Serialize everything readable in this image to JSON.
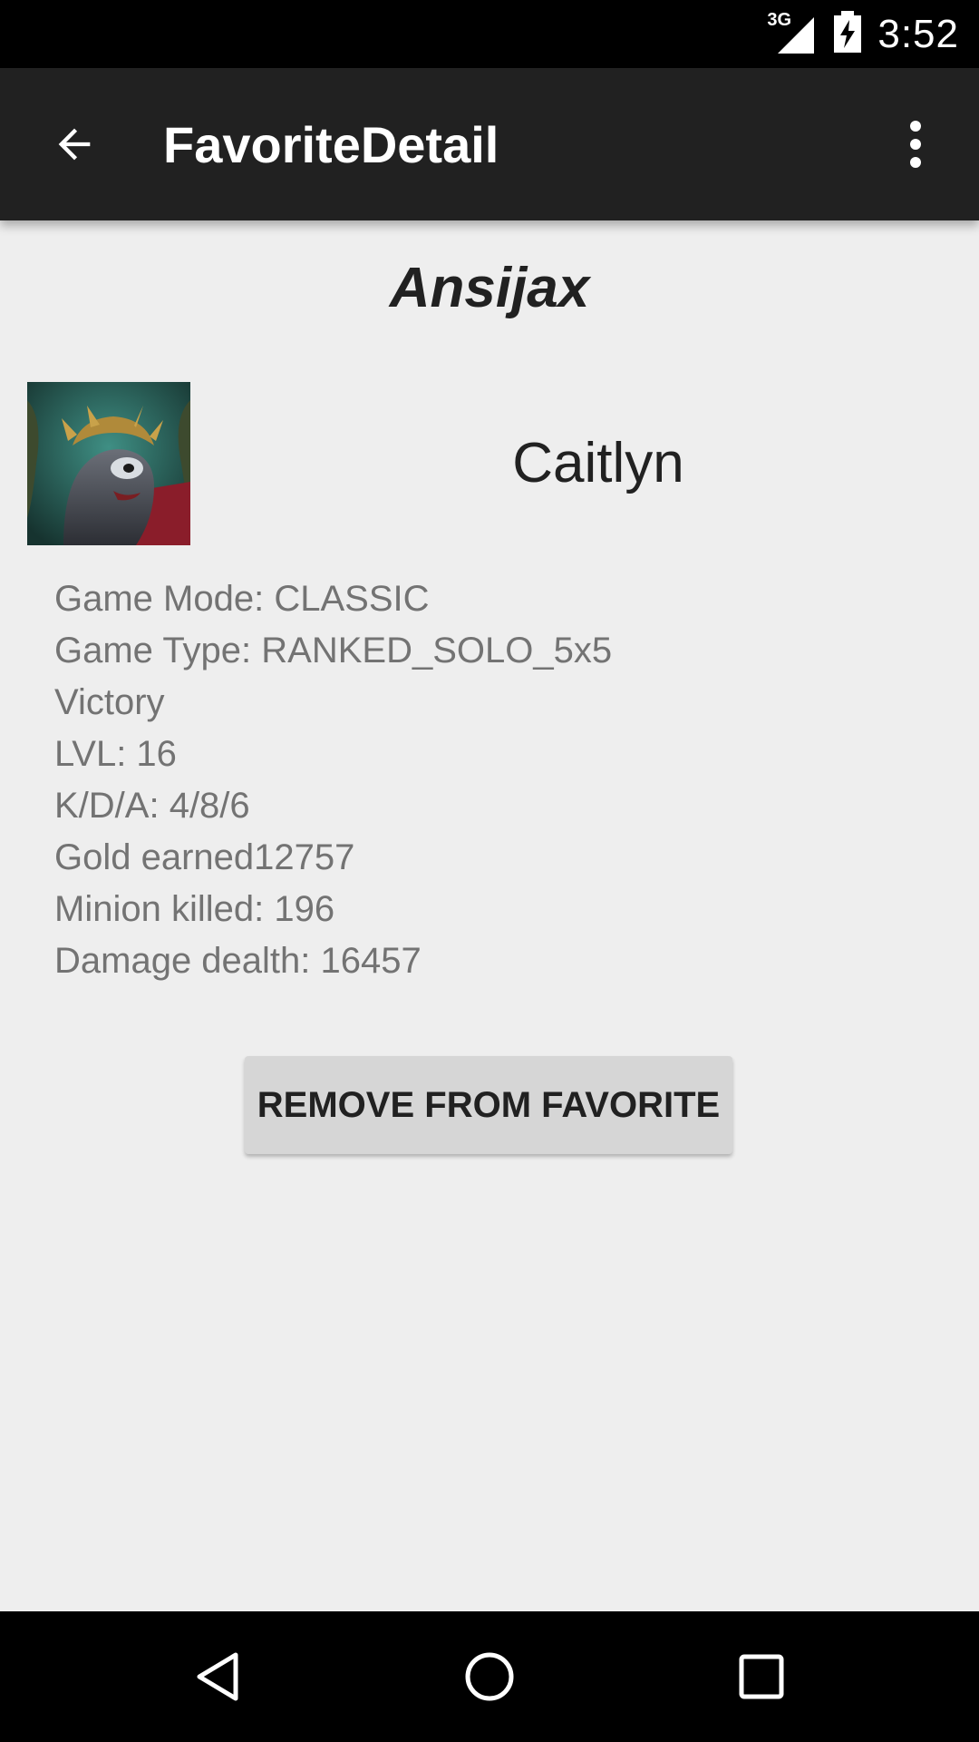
{
  "status_bar": {
    "network_type": "3G",
    "time": "3:52",
    "icons": [
      "signal-icon",
      "battery-charging-icon"
    ]
  },
  "app_bar": {
    "title": "FavoriteDetail",
    "back_icon": "arrow-back-icon",
    "menu_icon": "more-vert-icon"
  },
  "detail": {
    "player_name": "Ansijax",
    "champion_name": "Caitlyn",
    "avatar_icon": "champion-portrait-icon",
    "stats": [
      "Game Mode: CLASSIC",
      "Game Type: RANKED_SOLO_5x5",
      "Victory",
      "LVL: 16",
      "K/D/A: 4/8/6",
      "Gold earned12757",
      "Minion killed: 196",
      "Damage dealth: 16457"
    ],
    "remove_button_label": "REMOVE FROM FAVORITE"
  },
  "nav_bar": {
    "icons": [
      "back-triangle-icon",
      "home-circle-icon",
      "recents-square-icon"
    ]
  }
}
